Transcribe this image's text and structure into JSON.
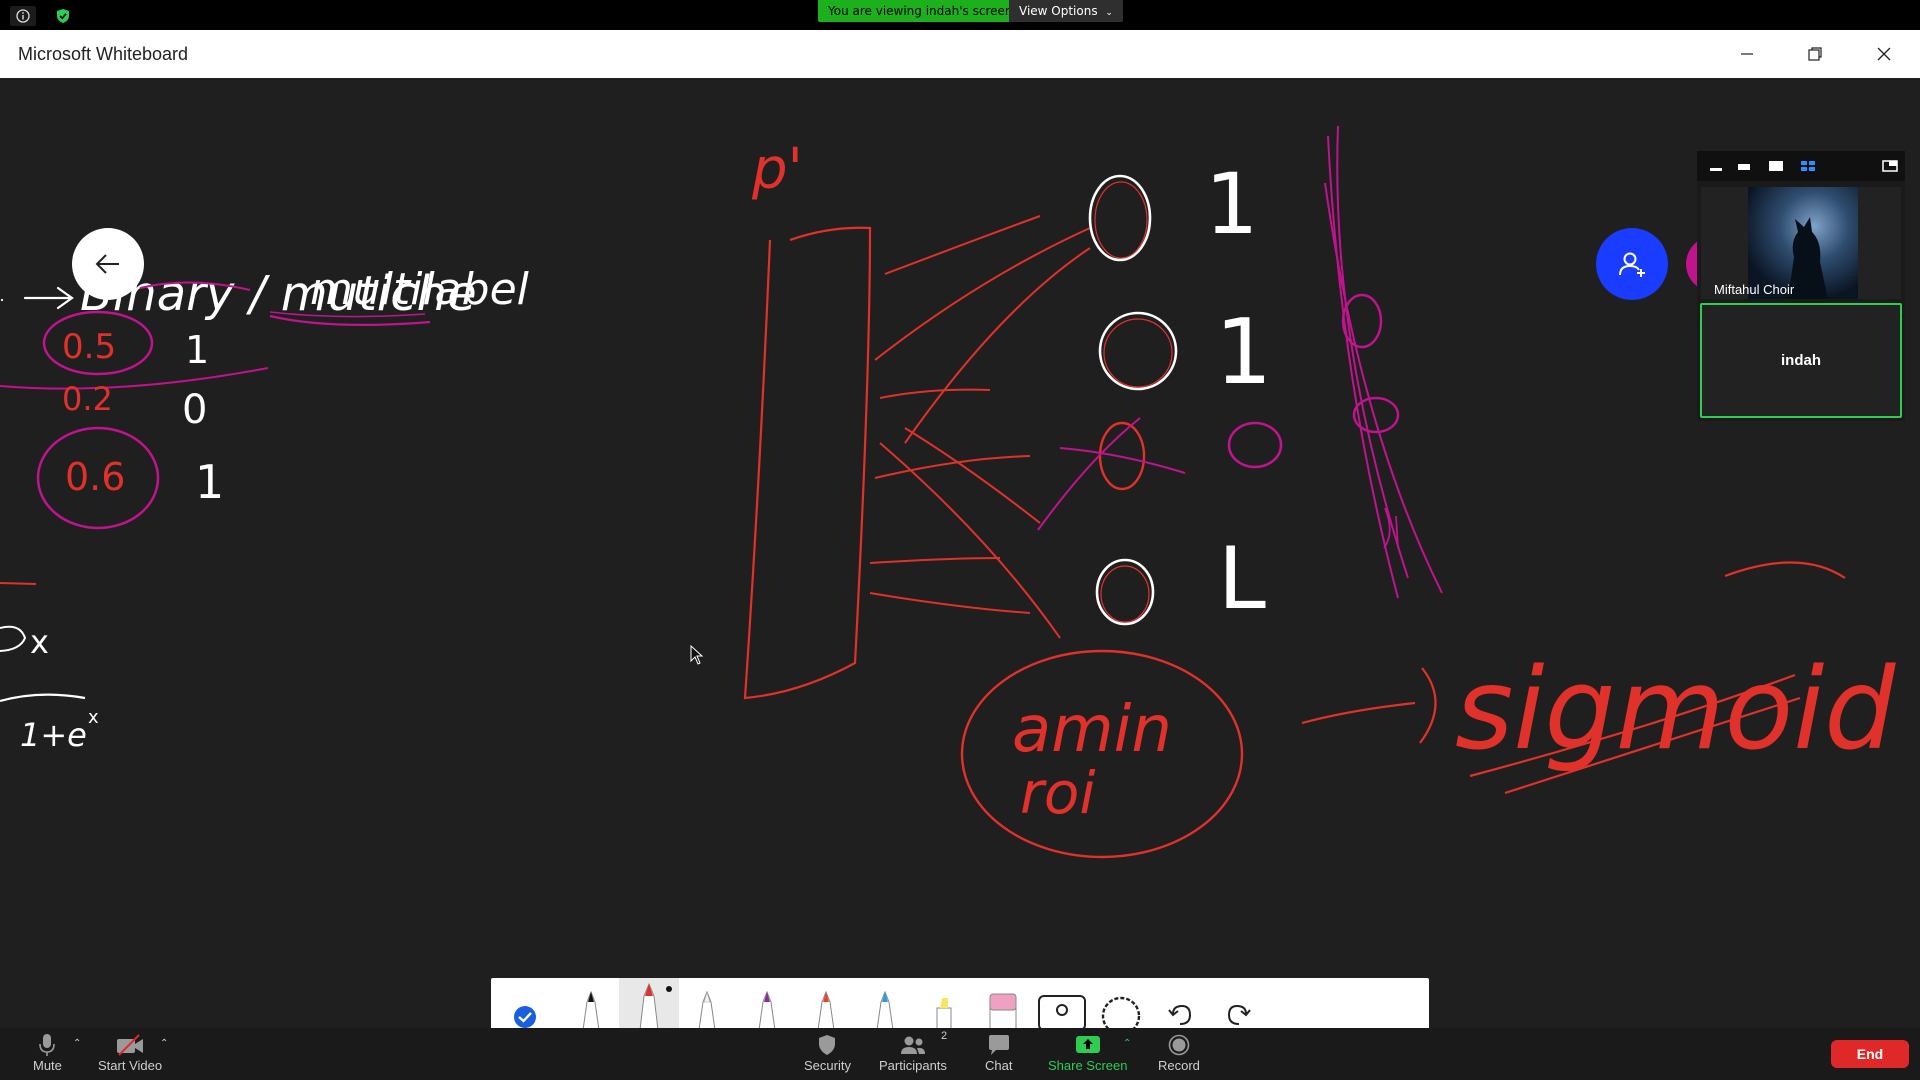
{
  "zoom_top": {
    "viewing_text": "You are viewing indah's screen",
    "view_options_label": "View Options"
  },
  "window": {
    "title": "Microsoft Whiteboard"
  },
  "whiteboard": {
    "handwriting": {
      "binary": "Binary / mutiche",
      "multilabel": "multilabel",
      "p1": "0.5",
      "p2": "0.2",
      "p3": "0.6",
      "l1": "1",
      "l2": "0",
      "l3": "1",
      "formula_x": "x",
      "formula_den": "1+e",
      "formula_den_exp": "x",
      "p_label": "p'",
      "col_a": [
        "0",
        "0",
        "0",
        "0"
      ],
      "col_b": [
        "1",
        "1",
        "0",
        "L"
      ],
      "amin_line1": "amin",
      "amin_line2": "roi",
      "sigmoid": "sigmoid"
    },
    "pen_colors": {
      "black": "#111111",
      "red": "#e0312b",
      "white": "#f5f5f5",
      "purple": "#8e2a9c",
      "orange_red": "#e5452f",
      "blue": "#2a9fd6",
      "highlighter": "#f5e663",
      "eraser": "#f0a0c0"
    }
  },
  "participants": [
    {
      "name": "Miftahul Choir"
    },
    {
      "name": "indah"
    }
  ],
  "bottom_bar": {
    "mute_label": "Mute",
    "video_label": "Start Video",
    "security_label": "Security",
    "participants_label": "Participants",
    "participants_count": "2",
    "chat_label": "Chat",
    "share_label": "Share Screen",
    "record_label": "Record",
    "end_label": "End"
  }
}
